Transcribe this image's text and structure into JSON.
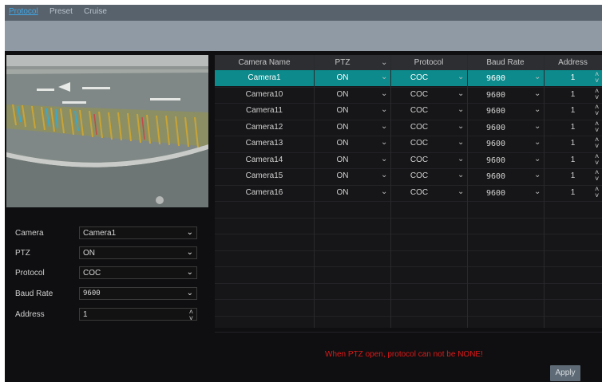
{
  "tabs": [
    {
      "label": "Protocol",
      "active": true
    },
    {
      "label": "Preset",
      "active": false
    },
    {
      "label": "Cruise",
      "active": false
    }
  ],
  "form": {
    "camera": {
      "label": "Camera",
      "value": "Camera1"
    },
    "ptz": {
      "label": "PTZ",
      "value": "ON"
    },
    "protocol": {
      "label": "Protocol",
      "value": "COC"
    },
    "baud_rate": {
      "label": "Baud Rate",
      "value": "9600"
    },
    "address": {
      "label": "Address",
      "value": "1"
    }
  },
  "table": {
    "headers": [
      "Camera Name",
      "PTZ",
      "Protocol",
      "Baud Rate",
      "Address"
    ],
    "rows": [
      [
        "Camera1",
        "ON",
        "COC",
        "9600",
        "1"
      ],
      [
        "Camera10",
        "ON",
        "COC",
        "9600",
        "1"
      ],
      [
        "Camera11",
        "ON",
        "COC",
        "9600",
        "1"
      ],
      [
        "Camera12",
        "ON",
        "COC",
        "9600",
        "1"
      ],
      [
        "Camera13",
        "ON",
        "COC",
        "9600",
        "1"
      ],
      [
        "Camera14",
        "ON",
        "COC",
        "9600",
        "1"
      ],
      [
        "Camera15",
        "ON",
        "COC",
        "9600",
        "1"
      ],
      [
        "Camera16",
        "ON",
        "COC",
        "9600",
        "1"
      ]
    ],
    "selected_row": 0
  },
  "warning": "When PTZ open, protocol can not be NONE!",
  "apply_label": "Apply",
  "colors": {
    "accent_tab": "#3fa7e6",
    "selected_row": "#0d8a8c",
    "warning": "#e01818"
  },
  "icons": {
    "dropdown": "chevron-down-icon",
    "spinner": "spinner-arrows-icon"
  }
}
